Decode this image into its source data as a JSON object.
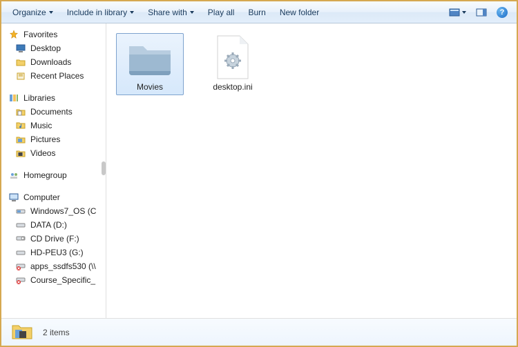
{
  "toolbar": {
    "organize": "Organize",
    "include": "Include in library",
    "share": "Share with",
    "play": "Play all",
    "burn": "Burn",
    "newfolder": "New folder"
  },
  "nav": {
    "favorites": {
      "label": "Favorites",
      "items": [
        "Desktop",
        "Downloads",
        "Recent Places"
      ]
    },
    "libraries": {
      "label": "Libraries",
      "items": [
        "Documents",
        "Music",
        "Pictures",
        "Videos"
      ]
    },
    "homegroup": {
      "label": "Homegroup"
    },
    "computer": {
      "label": "Computer",
      "items": [
        "Windows7_OS (C",
        "DATA (D:)",
        "CD Drive (F:)",
        "HD-PEU3 (G:)",
        "apps_ssdfs530 (\\\\",
        "Course_Specific_"
      ]
    }
  },
  "content": {
    "items": [
      {
        "name": "Movies",
        "type": "folder",
        "selected": true
      },
      {
        "name": "desktop.ini",
        "type": "ini",
        "selected": false
      }
    ]
  },
  "status": {
    "count": "2 items"
  }
}
